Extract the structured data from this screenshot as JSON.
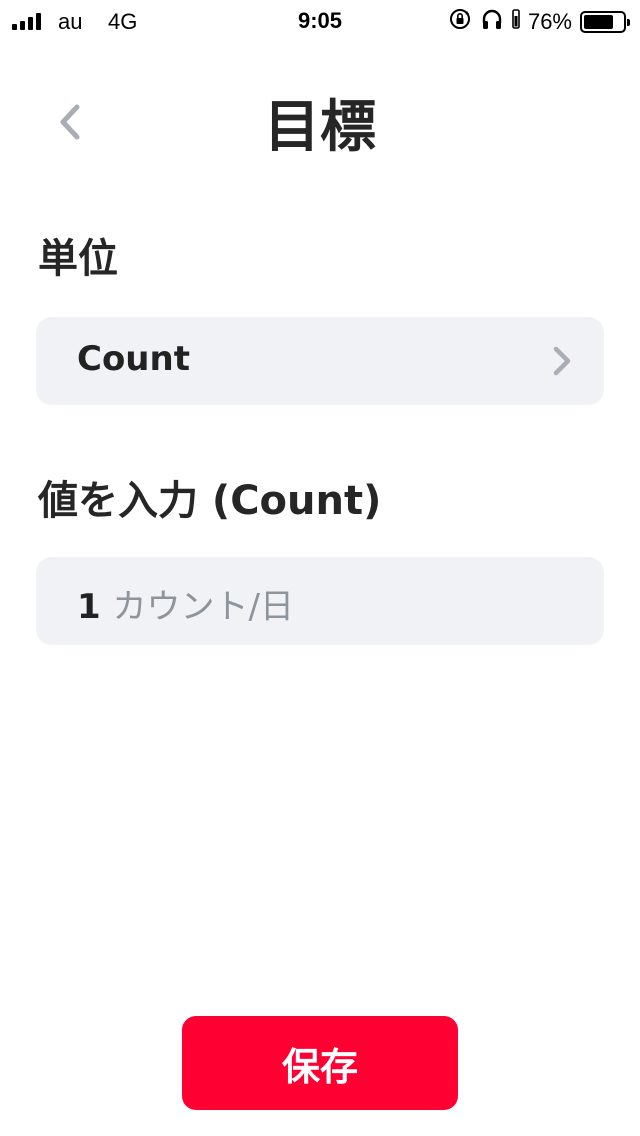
{
  "status_bar": {
    "carrier": "au",
    "network": "4G",
    "time": "9:05",
    "battery_percent": "76%",
    "battery_level": 0.76,
    "icons": [
      "signal-icon",
      "rotation-lock-icon",
      "headphones-icon",
      "battery-icon"
    ]
  },
  "header": {
    "back_icon": "chevron-left-icon",
    "title": "目標"
  },
  "unit_section": {
    "label": "単位",
    "value": "Count",
    "chevron_icon": "chevron-right-icon"
  },
  "value_section": {
    "label": "値を入力 (Count)",
    "value_number": "1",
    "value_unit": "カウント/日"
  },
  "save_button": {
    "label": "保存",
    "color": "#ff0033"
  },
  "colors": {
    "field_background": "#f1f2f6",
    "muted_text": "#8e949c",
    "icon_gray": "#a9aeb6"
  }
}
